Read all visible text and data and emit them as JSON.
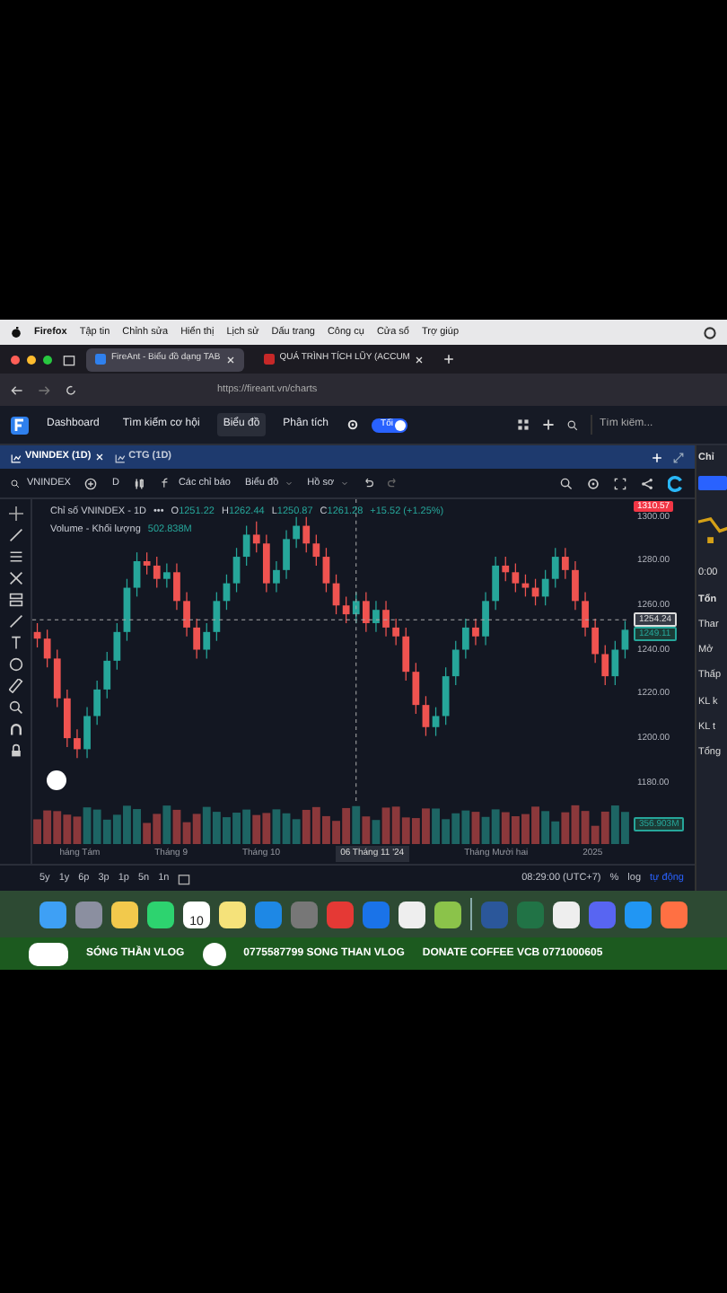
{
  "menu_bar": {
    "items": [
      {
        "label": "Firefox",
        "bold": true
      },
      {
        "label": "Tập tin",
        "bold": false
      },
      {
        "label": "Chỉnh sửa",
        "bold": false
      },
      {
        "label": "Hiển thị",
        "bold": false
      },
      {
        "label": "Lịch sử",
        "bold": false
      },
      {
        "label": "Dấu trang",
        "bold": false
      },
      {
        "label": "Công cụ",
        "bold": false
      },
      {
        "label": "Cửa sổ",
        "bold": false
      },
      {
        "label": "Trợ giúp",
        "bold": false
      }
    ]
  },
  "browser_tabs": [
    {
      "label": "FireAnt - Biểu đồ dạng TAB",
      "selected": true
    },
    {
      "label": "QUÁ TRÌNH TÍCH LŨY (ACCUM",
      "selected": false
    }
  ],
  "address": "https://fireant.vn/charts",
  "app_nav": {
    "items": [
      {
        "label": "Dashboard",
        "selected": false
      },
      {
        "label": "Tìm kiếm cơ hội",
        "selected": false
      },
      {
        "label": "Biểu đồ",
        "selected": true
      },
      {
        "label": "Phân tích",
        "selected": false
      }
    ],
    "toggle": {
      "label": "Tối",
      "on": true
    },
    "search": {
      "placeholder": "Tìm kiếm..."
    }
  },
  "chart_tabs": [
    {
      "label": "VNINDEX (1D)",
      "selected": true
    },
    {
      "label": "CTG (1D)",
      "selected": false
    }
  ],
  "toolbar": {
    "symbol": "VNINDEX",
    "interval": "D",
    "indicators": "Các chỉ báo",
    "chart_type": "Biểu đồ",
    "profile": "Hồ sơ"
  },
  "chart": {
    "chart_data": {
      "type": "candlestick",
      "ylim": [
        1170,
        1308
      ],
      "categories": [
        null,
        null,
        null,
        null,
        null,
        null,
        null,
        null,
        null,
        null,
        null,
        null,
        null,
        null,
        null,
        null,
        null,
        null,
        null,
        null,
        null,
        null,
        null,
        null,
        null,
        null,
        null,
        null,
        null,
        null,
        null,
        null,
        null,
        null,
        null,
        null,
        null,
        null,
        null,
        null,
        null,
        null,
        null,
        null,
        null,
        null,
        null,
        null,
        null,
        null,
        null,
        null,
        null,
        null,
        null,
        null,
        null,
        null,
        null,
        null
      ],
      "yticks": [
        {
          "value": 1300,
          "label": "1300.00"
        },
        {
          "value": 1280,
          "label": "1280.00"
        },
        {
          "value": 1260,
          "label": "1260.00"
        },
        {
          "value": 1240,
          "label": "1240.00"
        },
        {
          "value": 1220,
          "label": "1220.00"
        },
        {
          "value": 1200,
          "label": "1200.00"
        },
        {
          "value": 1180,
          "label": "1180.00"
        }
      ],
      "ohlc": [
        [
          1248,
          1252,
          1241,
          1245
        ],
        [
          1245,
          1249,
          1232,
          1236
        ],
        [
          1236,
          1240,
          1214,
          1218
        ],
        [
          1218,
          1222,
          1196,
          1200
        ],
        [
          1200,
          1204,
          1191,
          1195
        ],
        [
          1195,
          1214,
          1191,
          1210
        ],
        [
          1210,
          1226,
          1206,
          1222
        ],
        [
          1222,
          1239,
          1218,
          1235
        ],
        [
          1235,
          1252,
          1231,
          1248
        ],
        [
          1248,
          1272,
          1244,
          1268
        ],
        [
          1268,
          1284,
          1264,
          1280
        ],
        [
          1280,
          1284,
          1274,
          1278
        ],
        [
          1278,
          1282,
          1268,
          1272
        ],
        [
          1272,
          1279,
          1268,
          1275
        ],
        [
          1275,
          1279,
          1258,
          1262
        ],
        [
          1262,
          1266,
          1246,
          1250
        ],
        [
          1250,
          1254,
          1236,
          1240
        ],
        [
          1240,
          1252,
          1236,
          1248
        ],
        [
          1248,
          1266,
          1244,
          1262
        ],
        [
          1262,
          1274,
          1258,
          1270
        ],
        [
          1270,
          1286,
          1266,
          1282
        ],
        [
          1282,
          1296,
          1278,
          1292
        ],
        [
          1292,
          1298,
          1284,
          1288
        ],
        [
          1288,
          1292,
          1266,
          1270
        ],
        [
          1270,
          1280,
          1266,
          1276
        ],
        [
          1276,
          1294,
          1272,
          1290
        ],
        [
          1290,
          1300,
          1286,
          1296
        ],
        [
          1296,
          1300,
          1284,
          1288
        ],
        [
          1288,
          1292,
          1278,
          1282
        ],
        [
          1282,
          1286,
          1266,
          1270
        ],
        [
          1270,
          1274,
          1256,
          1260
        ],
        [
          1260,
          1264,
          1252,
          1256
        ],
        [
          1256,
          1266,
          1252,
          1262
        ],
        [
          1262,
          1266,
          1248,
          1252
        ],
        [
          1252,
          1262,
          1248,
          1258
        ],
        [
          1258,
          1262,
          1246,
          1250
        ],
        [
          1250,
          1254,
          1242,
          1246
        ],
        [
          1246,
          1250,
          1226,
          1230
        ],
        [
          1230,
          1234,
          1211,
          1215
        ],
        [
          1215,
          1219,
          1201,
          1205
        ],
        [
          1205,
          1214,
          1201,
          1210
        ],
        [
          1210,
          1232,
          1206,
          1228
        ],
        [
          1228,
          1244,
          1224,
          1240
        ],
        [
          1240,
          1254,
          1236,
          1250
        ],
        [
          1250,
          1254,
          1242,
          1246
        ],
        [
          1246,
          1266,
          1242,
          1262
        ],
        [
          1262,
          1282,
          1258,
          1278
        ],
        [
          1278,
          1282,
          1271,
          1275
        ],
        [
          1275,
          1279,
          1266,
          1270
        ],
        [
          1270,
          1274,
          1264,
          1268
        ],
        [
          1268,
          1272,
          1260,
          1264
        ],
        [
          1264,
          1276,
          1260,
          1272
        ],
        [
          1272,
          1286,
          1268,
          1282
        ],
        [
          1282,
          1286,
          1272,
          1276
        ],
        [
          1276,
          1280,
          1258,
          1262
        ],
        [
          1262,
          1266,
          1246,
          1250
        ],
        [
          1250,
          1254,
          1234,
          1238
        ],
        [
          1238,
          1242,
          1224,
          1228
        ],
        [
          1228,
          1244,
          1224,
          1240
        ],
        [
          1240,
          1253,
          1236,
          1249
        ]
      ]
    }
  },
  "legend": {
    "title": "Chỉ số VNINDEX - 1D",
    "more": "•••",
    "ohlc": [
      {
        "key": "O",
        "value": "1251.22"
      },
      {
        "key": "H",
        "value": "1262.44"
      },
      {
        "key": "L",
        "value": "1250.87"
      },
      {
        "key": "C",
        "value": "1261.28"
      }
    ],
    "change": "+15.52 (+1.25%)",
    "volume_label": "Volume - Khối lượng",
    "volume_value": "502.838M"
  },
  "price_tags": [
    {
      "text": "1310.57",
      "kind": "high"
    },
    {
      "text": "1254.24",
      "kind": "crosshair"
    },
    {
      "text": "1249.11",
      "kind": "last"
    },
    {
      "text": "356.903M",
      "kind": "volume"
    }
  ],
  "time_axis": [
    {
      "label": "háng Tám",
      "selected": false
    },
    {
      "label": "Tháng 9",
      "selected": false
    },
    {
      "label": "Tháng 10",
      "selected": false
    },
    {
      "label": "06 Tháng 11 '24",
      "selected": true
    },
    {
      "label": "Tháng Mười hai",
      "selected": false
    },
    {
      "label": "2025",
      "selected": false
    }
  ],
  "bottom_bar": {
    "ranges": [
      "5y",
      "1y",
      "6p",
      "3p",
      "1p",
      "5n",
      "1n"
    ],
    "time": "08:29:00 (UTC+7)",
    "options": [
      {
        "label": "%",
        "selected": false
      },
      {
        "label": "log",
        "selected": false
      },
      {
        "label": "tự động",
        "selected": true
      }
    ]
  },
  "side_panel": {
    "title": "Chỉ",
    "time": "0:00",
    "heading": "Tổn",
    "rows": [
      "Thar",
      "Mở",
      "Thấp",
      "KL k",
      "KL t",
      "Tổng"
    ]
  },
  "dock": {
    "calendar_day": "10"
  },
  "banner": {
    "channel": "SÓNG THẦN VLOG",
    "phone": "0775587799 SONG THAN VLOG",
    "donate": "DONATE COFFEE  VCB 0771000605"
  }
}
